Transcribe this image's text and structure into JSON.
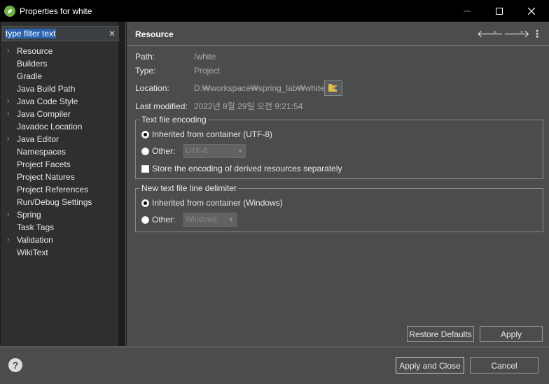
{
  "window": {
    "title": "Properties for white",
    "icons": {
      "app": "spring-leaf-icon",
      "minimize": "minimize-icon",
      "maximize": "maximize-icon",
      "close": "close-icon"
    }
  },
  "filter": {
    "text": "type filter text",
    "clear_icon": "clear-icon"
  },
  "tree": {
    "items": [
      {
        "label": "Resource",
        "expandable": true
      },
      {
        "label": "Builders",
        "expandable": false
      },
      {
        "label": "Gradle",
        "expandable": false
      },
      {
        "label": "Java Build Path",
        "expandable": false
      },
      {
        "label": "Java Code Style",
        "expandable": true
      },
      {
        "label": "Java Compiler",
        "expandable": true
      },
      {
        "label": "Javadoc Location",
        "expandable": false
      },
      {
        "label": "Java Editor",
        "expandable": true
      },
      {
        "label": "Namespaces",
        "expandable": false
      },
      {
        "label": "Project Facets",
        "expandable": false
      },
      {
        "label": "Project Natures",
        "expandable": false
      },
      {
        "label": "Project References",
        "expandable": false
      },
      {
        "label": "Run/Debug Settings",
        "expandable": false
      },
      {
        "label": "Spring",
        "expandable": true
      },
      {
        "label": "Task Tags",
        "expandable": false
      },
      {
        "label": "Validation",
        "expandable": true
      },
      {
        "label": "WikiText",
        "expandable": false
      }
    ]
  },
  "header": {
    "title": "Resource",
    "icons": {
      "back": "back-arrow-icon",
      "forward": "forward-arrow-icon",
      "menu": "more-vert-icon"
    }
  },
  "info": {
    "path_label": "Path:",
    "path_value": "/white",
    "type_label": "Type:",
    "type_value": "Project",
    "location_label": "Location:",
    "location_value": "D:₩workspace₩spring_lab₩white",
    "modified_label": "Last modified:",
    "modified_value": "2022년 8월 29일 오전 9:21:54",
    "location_button_icon": "open-folder-icon"
  },
  "encoding": {
    "title": "Text file encoding",
    "inherited": "Inherited from container (UTF-8)",
    "other": "Other:",
    "other_value": "UTF-8",
    "store_derived": "Store the encoding of derived resources separately"
  },
  "delimiter": {
    "title": "New text file line delimiter",
    "inherited": "Inherited from container (Windows)",
    "other": "Other:",
    "other_value": "Windows"
  },
  "buttons": {
    "restore": "Restore Defaults",
    "apply": "Apply",
    "apply_close": "Apply and Close",
    "cancel": "Cancel",
    "help_icon": "help-icon"
  },
  "colors": {
    "selection": "#2a62b0",
    "pane": "#4a4c4e",
    "tree_bg": "#2f2f2f"
  }
}
